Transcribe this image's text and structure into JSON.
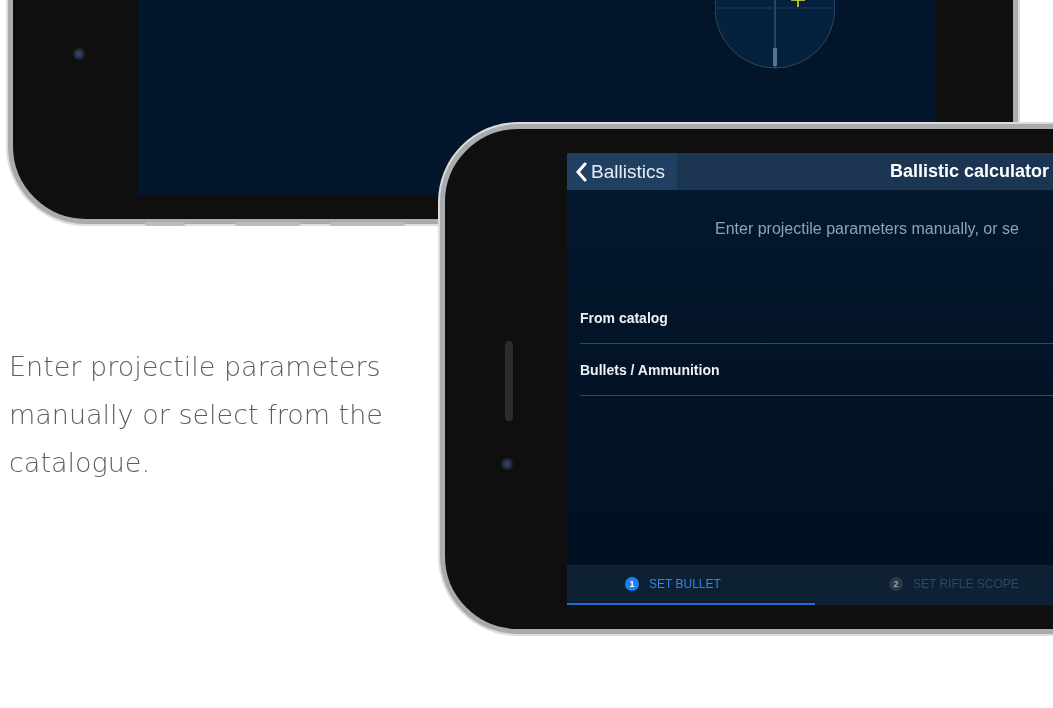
{
  "caption": "Enter projectile parameters manually or select from the catalogue.",
  "app": {
    "back_label": "Ballistics",
    "title": "Ballistic calculator",
    "intro": "Enter projectile parameters manually, or se",
    "rows": [
      {
        "label": "From catalog"
      },
      {
        "label": "Bullets / Ammunition"
      }
    ],
    "tabs": [
      {
        "number": "1",
        "label": "SET BULLET",
        "selected": true
      },
      {
        "number": "2",
        "label": "SET RIFLE SCOPE",
        "selected": false
      }
    ]
  }
}
